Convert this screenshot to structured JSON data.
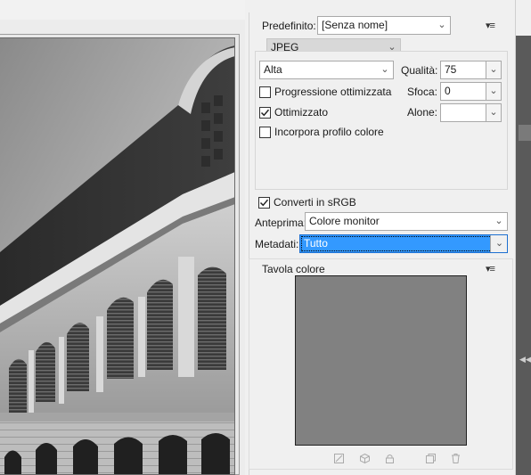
{
  "settings": {
    "preset_label": "Predefinito:",
    "preset_value": "[Senza nome]",
    "format_value": "JPEG",
    "quality_level_value": "Alta",
    "quality_label": "Qualità:",
    "quality_value": "75",
    "progressive_label": "Progressione ottimizzata",
    "progressive_checked": false,
    "blur_label": "Sfoca:",
    "blur_value": "0",
    "optimized_label": "Ottimizzato",
    "optimized_checked": true,
    "matte_label": "Alone:",
    "matte_value": "",
    "embed_profile_label": "Incorpora profilo colore",
    "embed_profile_checked": false,
    "convert_srgb_label": "Converti in sRGB",
    "convert_srgb_checked": true,
    "preview_label": "Anteprima:",
    "preview_value": "Colore monitor",
    "metadata_label": "Metadati:",
    "metadata_value": "Tutto"
  },
  "color_table": {
    "title": "Tavola colore",
    "swatch_color": "#818181",
    "icons": [
      "map-transparency-icon",
      "web-shift-icon",
      "lock-color-icon",
      "new-color-icon",
      "delete-color-icon"
    ]
  },
  "preview_image": {
    "subject": "black and white photo of classical building facade with dome"
  }
}
